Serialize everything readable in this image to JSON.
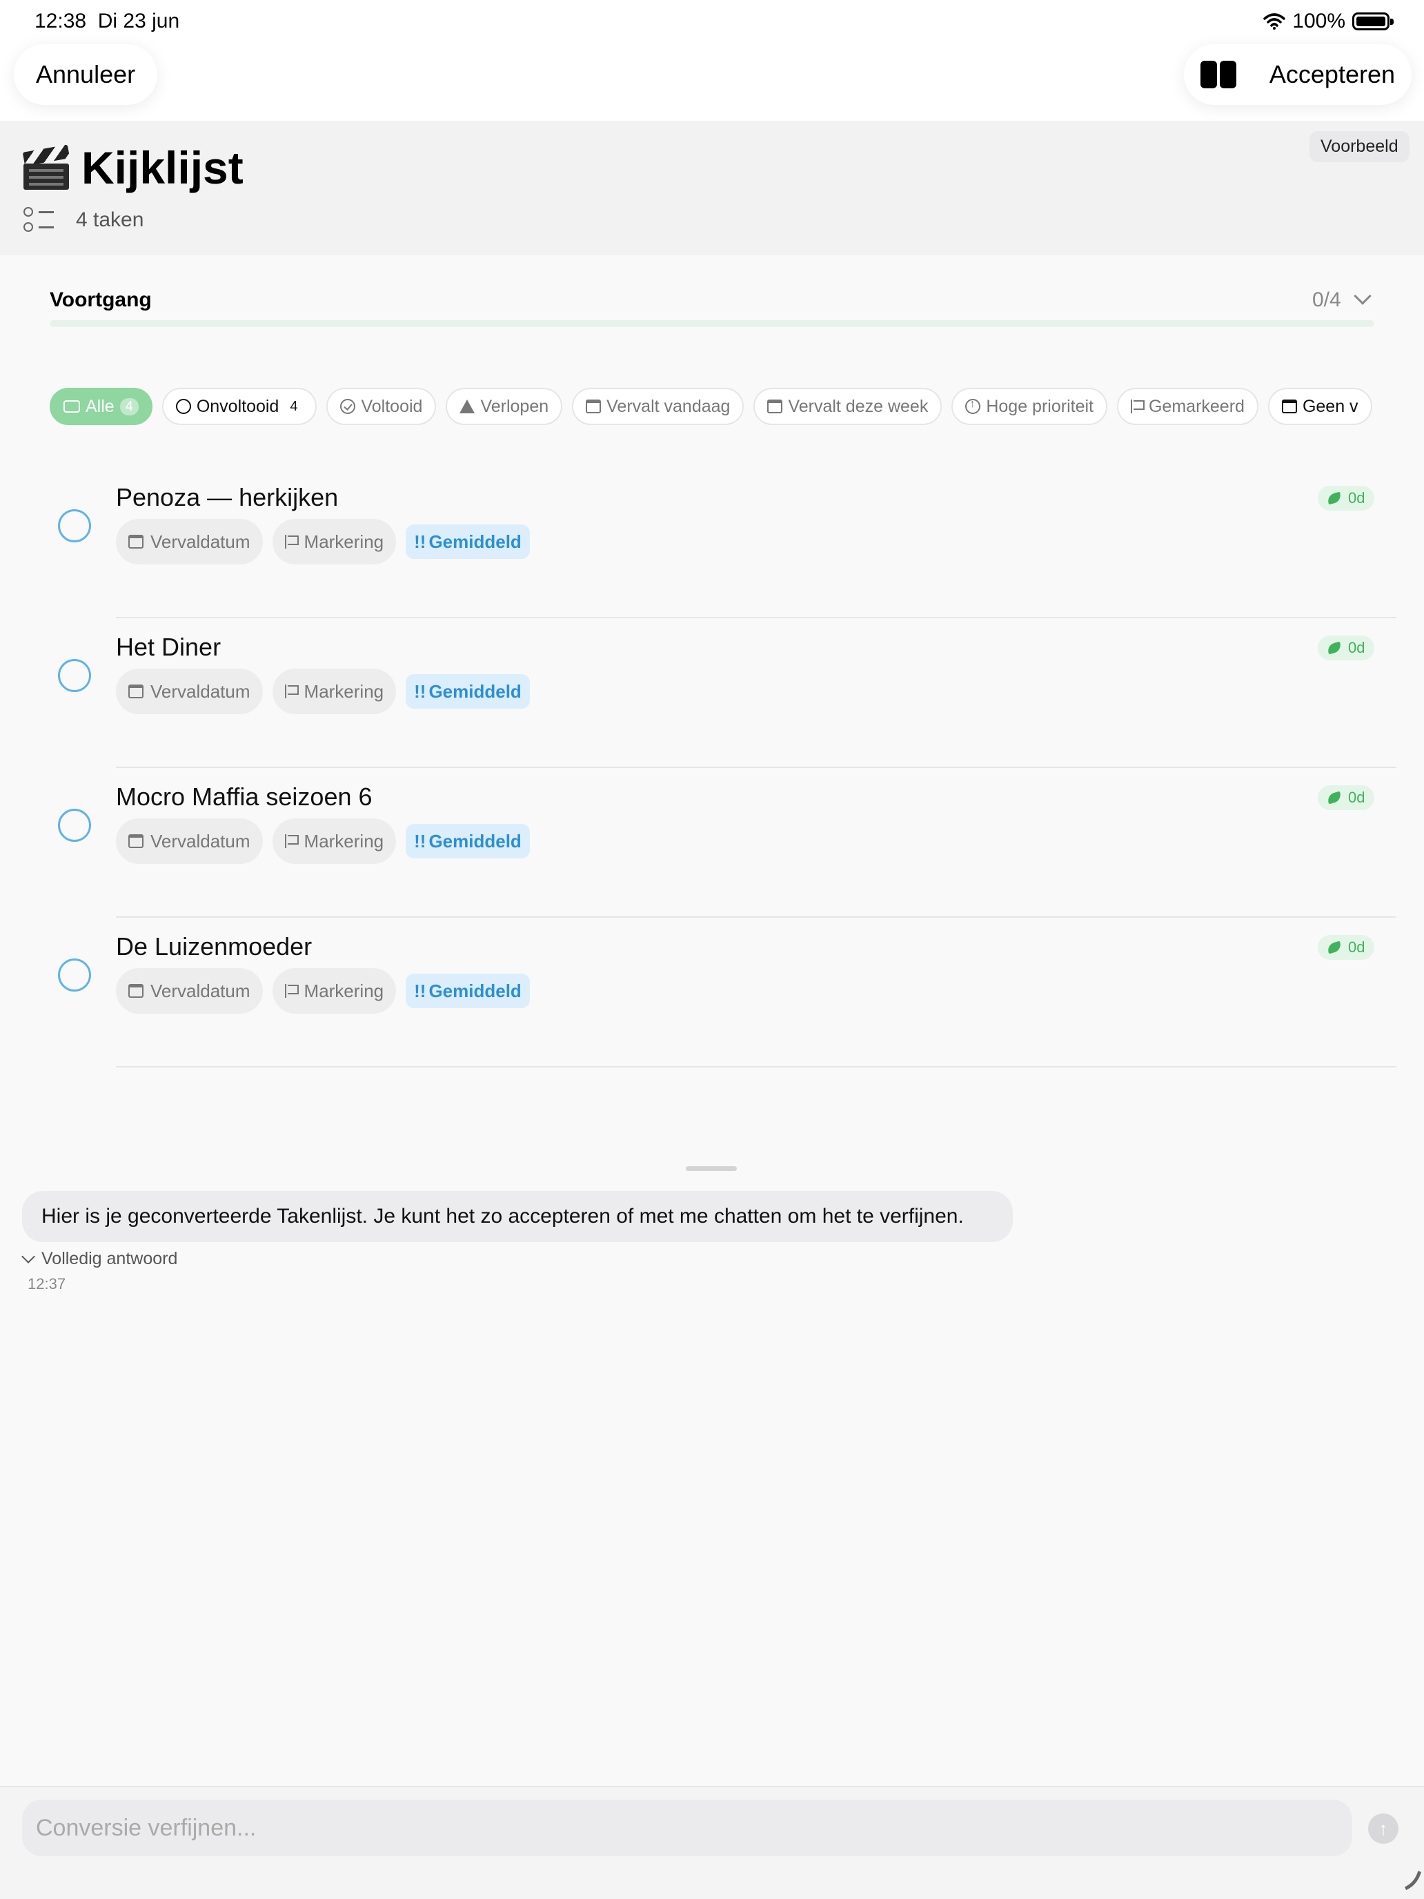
{
  "status_bar": {
    "time": "12:38",
    "date": "Di 23 jun",
    "battery": "100%"
  },
  "toolbar": {
    "cancel_label": "Annuleer",
    "accept_label": "Accepteren",
    "split_icon": "split-view-icon"
  },
  "preview_badge": "Voorbeeld",
  "list": {
    "title": "Kijklijst",
    "emoji_icon": "clapperboard-icon",
    "task_count": "4 taken"
  },
  "progress": {
    "label": "Voortgang",
    "value": "0/4",
    "fraction": 0
  },
  "filters": [
    {
      "label": "Alle",
      "count": "4",
      "icon": "inbox-icon",
      "active": true
    },
    {
      "label": "Onvoltooid",
      "count": "4",
      "icon": "circle-icon"
    },
    {
      "label": "Voltooid",
      "icon": "check-circle-icon"
    },
    {
      "label": "Verlopen",
      "icon": "warning-icon"
    },
    {
      "label": "Vervalt vandaag",
      "icon": "calendar-icon"
    },
    {
      "label": "Vervalt deze week",
      "icon": "calendar-icon"
    },
    {
      "label": "Hoge prioriteit",
      "icon": "arrow-up-circle-icon"
    },
    {
      "label": "Gemarkeerd",
      "icon": "flag-icon"
    },
    {
      "label": "Geen v",
      "icon": "calendar-icon"
    }
  ],
  "tasks": [
    {
      "title": "Penoza — herkijken",
      "due_label": "Vervaldatum",
      "flag_label": "Markering",
      "priority_mark": "!!",
      "priority_label": "Gemiddeld",
      "badge": "0d"
    },
    {
      "title": "Het Diner",
      "due_label": "Vervaldatum",
      "flag_label": "Markering",
      "priority_mark": "!!",
      "priority_label": "Gemiddeld",
      "badge": "0d"
    },
    {
      "title": "Mocro Maffia seizoen 6",
      "due_label": "Vervaldatum",
      "flag_label": "Markering",
      "priority_mark": "!!",
      "priority_label": "Gemiddeld",
      "badge": "0d"
    },
    {
      "title": "De Luizenmoeder",
      "due_label": "Vervaldatum",
      "flag_label": "Markering",
      "priority_mark": "!!",
      "priority_label": "Gemiddeld",
      "badge": "0d"
    }
  ],
  "chat": {
    "message": "Hier is je geconverteerde Takenlijst. Je kunt het zo accepteren of met me chatten om het te verfijnen.",
    "full_answer_label": "Volledig antwoord",
    "time": "12:37"
  },
  "input": {
    "placeholder": "Conversie verfijnen...",
    "value": ""
  },
  "colors": {
    "accent_green": "#4cc764",
    "check_blue": "#5eb3ea",
    "priority_blue": "#2b8fd8"
  }
}
